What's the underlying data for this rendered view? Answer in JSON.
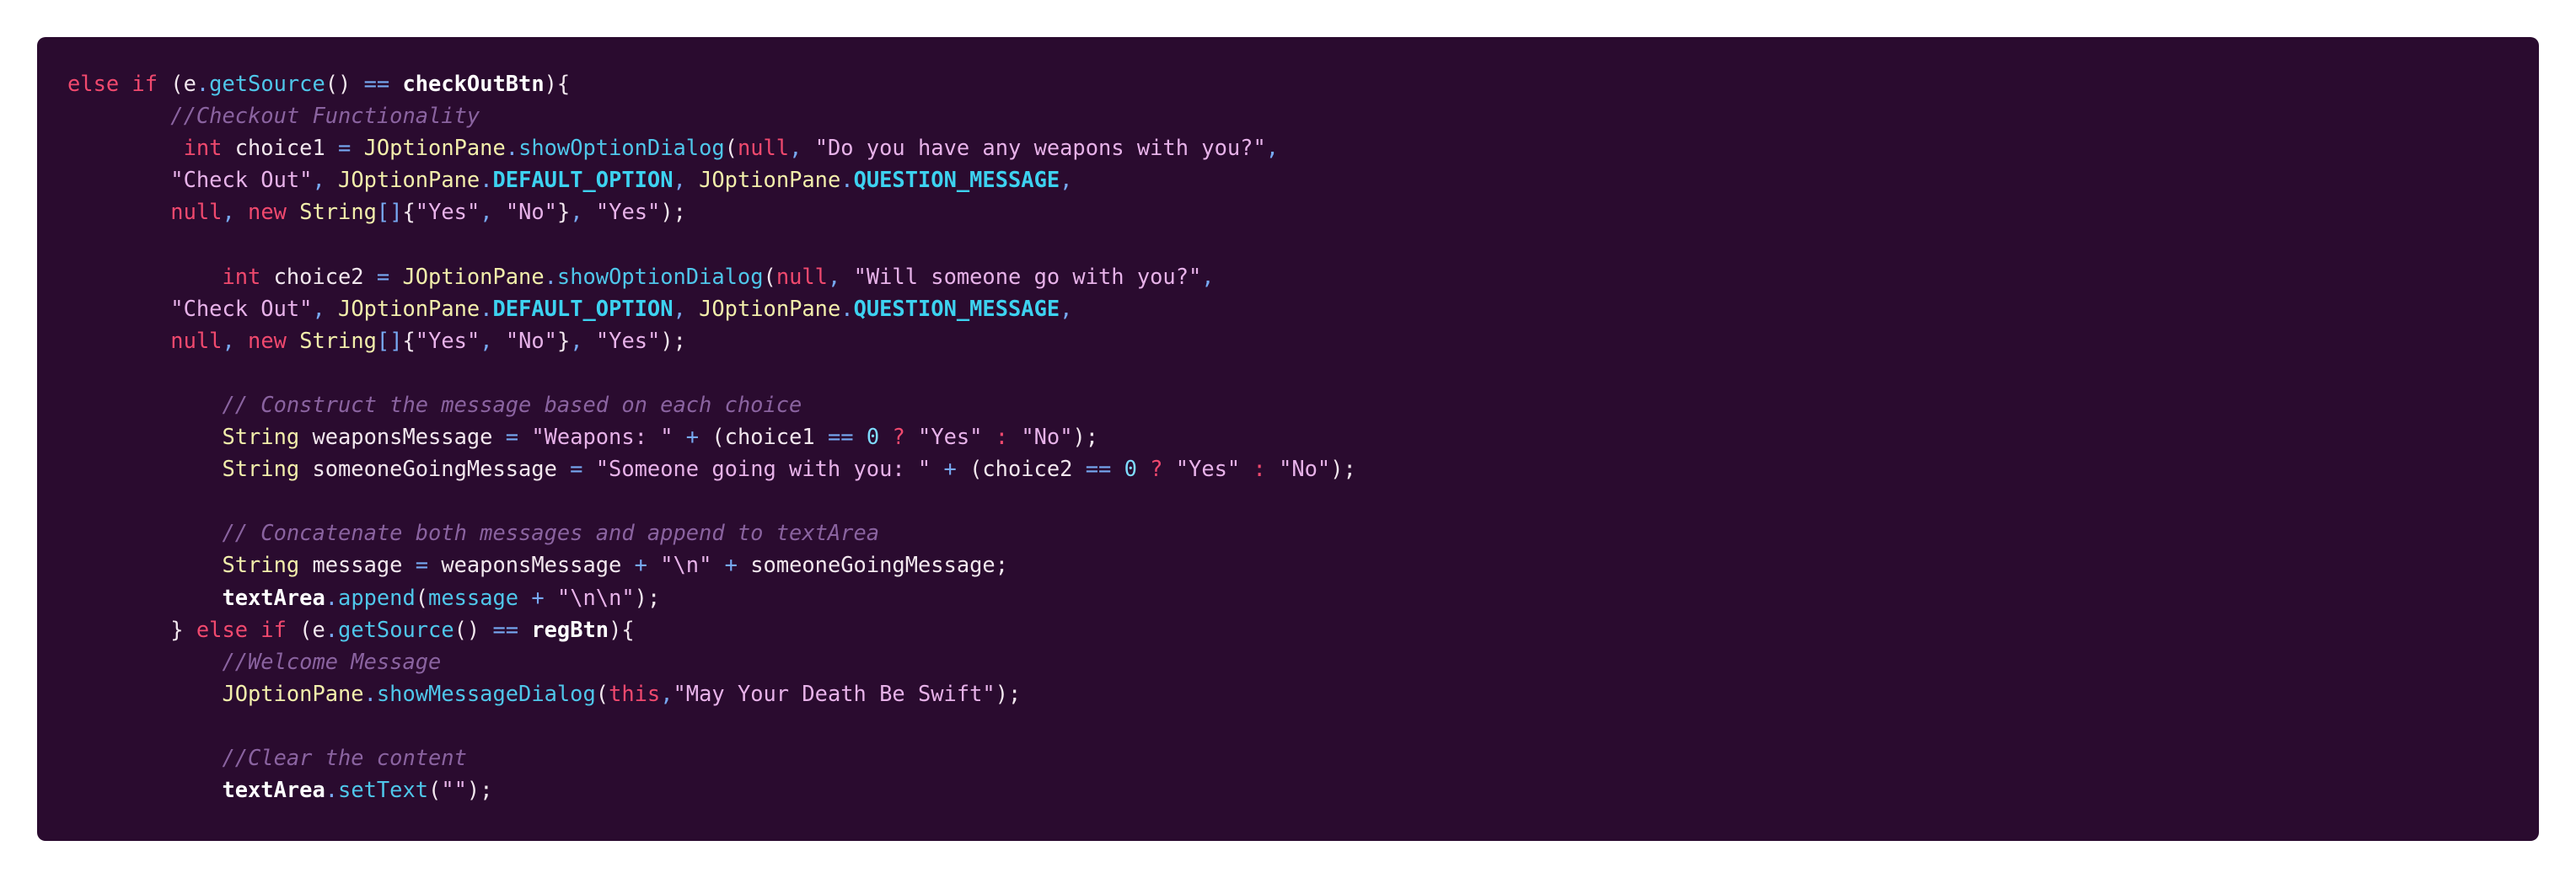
{
  "colors": {
    "background": "#2a0b2f",
    "keyword": "#f0496e",
    "type": "#f2eeab",
    "method": "#4fc6ea",
    "string": "#e7b2e9",
    "comment": "#8a63a0",
    "number": "#7fdcff",
    "operator": "#77a9f3",
    "constant": "#3dd2f0",
    "plain": "#f2e7ee"
  },
  "lines": [
    [
      [
        "keyword",
        "else if"
      ],
      [
        "plain",
        " (e"
      ],
      [
        "op",
        "."
      ],
      [
        "method",
        "getSource"
      ],
      [
        "plain",
        "() "
      ],
      [
        "op",
        "=="
      ],
      [
        "plain",
        " "
      ],
      [
        "bold",
        "checkOutBtn"
      ],
      [
        "plain",
        "){"
      ]
    ],
    [
      [
        "plain",
        "        "
      ],
      [
        "comment",
        "//Checkout Functionality"
      ]
    ],
    [
      [
        "plain",
        "         "
      ],
      [
        "keyword",
        "int"
      ],
      [
        "plain",
        " choice1 "
      ],
      [
        "op",
        "="
      ],
      [
        "plain",
        " "
      ],
      [
        "type",
        "JOptionPane"
      ],
      [
        "op",
        "."
      ],
      [
        "method",
        "showOptionDialog"
      ],
      [
        "plain",
        "("
      ],
      [
        "keyword",
        "null"
      ],
      [
        "op",
        ","
      ],
      [
        "plain",
        " "
      ],
      [
        "string",
        "\"Do you have any weapons with you?\""
      ],
      [
        "op",
        ","
      ]
    ],
    [
      [
        "plain",
        "        "
      ],
      [
        "string",
        "\"Check Out\""
      ],
      [
        "op",
        ","
      ],
      [
        "plain",
        " "
      ],
      [
        "type",
        "JOptionPane"
      ],
      [
        "op",
        "."
      ],
      [
        "constant",
        "DEFAULT_OPTION"
      ],
      [
        "op",
        ","
      ],
      [
        "plain",
        " "
      ],
      [
        "type",
        "JOptionPane"
      ],
      [
        "op",
        "."
      ],
      [
        "constant",
        "QUESTION_MESSAGE"
      ],
      [
        "op",
        ","
      ]
    ],
    [
      [
        "plain",
        "        "
      ],
      [
        "keyword",
        "null"
      ],
      [
        "op",
        ","
      ],
      [
        "plain",
        " "
      ],
      [
        "keyword",
        "new"
      ],
      [
        "plain",
        " "
      ],
      [
        "type",
        "String"
      ],
      [
        "op",
        "[]"
      ],
      [
        "plain",
        "{"
      ],
      [
        "string",
        "\"Yes\""
      ],
      [
        "op",
        ","
      ],
      [
        "plain",
        " "
      ],
      [
        "string",
        "\"No\""
      ],
      [
        "plain",
        "}"
      ],
      [
        "op",
        ","
      ],
      [
        "plain",
        " "
      ],
      [
        "string",
        "\"Yes\""
      ],
      [
        "plain",
        ");"
      ]
    ],
    [
      [
        "plain",
        ""
      ]
    ],
    [
      [
        "plain",
        "            "
      ],
      [
        "keyword",
        "int"
      ],
      [
        "plain",
        " choice2 "
      ],
      [
        "op",
        "="
      ],
      [
        "plain",
        " "
      ],
      [
        "type",
        "JOptionPane"
      ],
      [
        "op",
        "."
      ],
      [
        "method",
        "showOptionDialog"
      ],
      [
        "plain",
        "("
      ],
      [
        "keyword",
        "null"
      ],
      [
        "op",
        ","
      ],
      [
        "plain",
        " "
      ],
      [
        "string",
        "\"Will someone go with you?\""
      ],
      [
        "op",
        ","
      ]
    ],
    [
      [
        "plain",
        "        "
      ],
      [
        "string",
        "\"Check Out\""
      ],
      [
        "op",
        ","
      ],
      [
        "plain",
        " "
      ],
      [
        "type",
        "JOptionPane"
      ],
      [
        "op",
        "."
      ],
      [
        "constant",
        "DEFAULT_OPTION"
      ],
      [
        "op",
        ","
      ],
      [
        "plain",
        " "
      ],
      [
        "type",
        "JOptionPane"
      ],
      [
        "op",
        "."
      ],
      [
        "constant",
        "QUESTION_MESSAGE"
      ],
      [
        "op",
        ","
      ]
    ],
    [
      [
        "plain",
        "        "
      ],
      [
        "keyword",
        "null"
      ],
      [
        "op",
        ","
      ],
      [
        "plain",
        " "
      ],
      [
        "keyword",
        "new"
      ],
      [
        "plain",
        " "
      ],
      [
        "type",
        "String"
      ],
      [
        "op",
        "[]"
      ],
      [
        "plain",
        "{"
      ],
      [
        "string",
        "\"Yes\""
      ],
      [
        "op",
        ","
      ],
      [
        "plain",
        " "
      ],
      [
        "string",
        "\"No\""
      ],
      [
        "plain",
        "}"
      ],
      [
        "op",
        ","
      ],
      [
        "plain",
        " "
      ],
      [
        "string",
        "\"Yes\""
      ],
      [
        "plain",
        ");"
      ]
    ],
    [
      [
        "plain",
        ""
      ]
    ],
    [
      [
        "plain",
        "            "
      ],
      [
        "comment",
        "// Construct the message based on each choice"
      ]
    ],
    [
      [
        "plain",
        "            "
      ],
      [
        "type",
        "String"
      ],
      [
        "plain",
        " weaponsMessage "
      ],
      [
        "op",
        "="
      ],
      [
        "plain",
        " "
      ],
      [
        "string",
        "\"Weapons: \""
      ],
      [
        "plain",
        " "
      ],
      [
        "op",
        "+"
      ],
      [
        "plain",
        " (choice1 "
      ],
      [
        "op",
        "=="
      ],
      [
        "plain",
        " "
      ],
      [
        "number",
        "0"
      ],
      [
        "plain",
        " "
      ],
      [
        "keyword",
        "?"
      ],
      [
        "plain",
        " "
      ],
      [
        "string",
        "\"Yes\""
      ],
      [
        "plain",
        " "
      ],
      [
        "keyword",
        ":"
      ],
      [
        "plain",
        " "
      ],
      [
        "string",
        "\"No\""
      ],
      [
        "plain",
        ");"
      ]
    ],
    [
      [
        "plain",
        "            "
      ],
      [
        "type",
        "String"
      ],
      [
        "plain",
        " someoneGoingMessage "
      ],
      [
        "op",
        "="
      ],
      [
        "plain",
        " "
      ],
      [
        "string",
        "\"Someone going with you: \""
      ],
      [
        "plain",
        " "
      ],
      [
        "op",
        "+"
      ],
      [
        "plain",
        " (choice2 "
      ],
      [
        "op",
        "=="
      ],
      [
        "plain",
        " "
      ],
      [
        "number",
        "0"
      ],
      [
        "plain",
        " "
      ],
      [
        "keyword",
        "?"
      ],
      [
        "plain",
        " "
      ],
      [
        "string",
        "\"Yes\""
      ],
      [
        "plain",
        " "
      ],
      [
        "keyword",
        ":"
      ],
      [
        "plain",
        " "
      ],
      [
        "string",
        "\"No\""
      ],
      [
        "plain",
        ");"
      ]
    ],
    [
      [
        "plain",
        ""
      ]
    ],
    [
      [
        "plain",
        "            "
      ],
      [
        "comment",
        "// Concatenate both messages and append to textArea"
      ]
    ],
    [
      [
        "plain",
        "            "
      ],
      [
        "type",
        "String"
      ],
      [
        "plain",
        " message "
      ],
      [
        "op",
        "="
      ],
      [
        "plain",
        " weaponsMessage "
      ],
      [
        "op",
        "+"
      ],
      [
        "plain",
        " "
      ],
      [
        "string",
        "\"\\n\""
      ],
      [
        "plain",
        " "
      ],
      [
        "op",
        "+"
      ],
      [
        "plain",
        " someoneGoingMessage;"
      ]
    ],
    [
      [
        "plain",
        "            "
      ],
      [
        "bold",
        "textArea"
      ],
      [
        "op",
        "."
      ],
      [
        "method",
        "append"
      ],
      [
        "plain",
        "("
      ],
      [
        "method",
        "message"
      ],
      [
        "plain",
        " "
      ],
      [
        "op",
        "+"
      ],
      [
        "plain",
        " "
      ],
      [
        "string",
        "\"\\n\\n\""
      ],
      [
        "plain",
        ");"
      ]
    ],
    [
      [
        "plain",
        "        } "
      ],
      [
        "keyword",
        "else if"
      ],
      [
        "plain",
        " (e"
      ],
      [
        "op",
        "."
      ],
      [
        "method",
        "getSource"
      ],
      [
        "plain",
        "() "
      ],
      [
        "op",
        "=="
      ],
      [
        "plain",
        " "
      ],
      [
        "bold",
        "regBtn"
      ],
      [
        "plain",
        "){"
      ]
    ],
    [
      [
        "plain",
        "            "
      ],
      [
        "comment",
        "//Welcome Message"
      ]
    ],
    [
      [
        "plain",
        "            "
      ],
      [
        "type",
        "JOptionPane"
      ],
      [
        "op",
        "."
      ],
      [
        "method",
        "showMessageDialog"
      ],
      [
        "plain",
        "("
      ],
      [
        "keyword",
        "this"
      ],
      [
        "op",
        ","
      ],
      [
        "string",
        "\"May Your Death Be Swift\""
      ],
      [
        "plain",
        ");"
      ]
    ],
    [
      [
        "plain",
        ""
      ]
    ],
    [
      [
        "plain",
        "            "
      ],
      [
        "comment",
        "//Clear the content"
      ]
    ],
    [
      [
        "plain",
        "            "
      ],
      [
        "bold",
        "textArea"
      ],
      [
        "op",
        "."
      ],
      [
        "method",
        "setText"
      ],
      [
        "plain",
        "("
      ],
      [
        "string",
        "\"\""
      ],
      [
        "plain",
        ");"
      ]
    ]
  ]
}
